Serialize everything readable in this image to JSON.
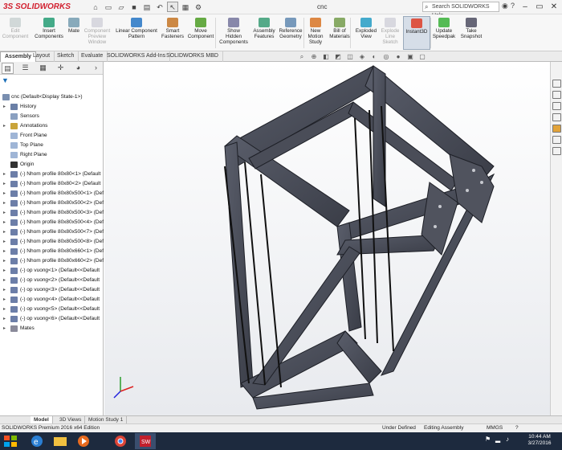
{
  "app": {
    "logo": "3S SOLIDWORKS",
    "window_title": "cnc",
    "search_placeholder": "Search SOLIDWORKS Help",
    "accent": "#d2202f"
  },
  "ribbon": {
    "buttons": [
      {
        "label1": "Edit",
        "label2": "Component",
        "enabled": false,
        "icon": "edit-component-icon"
      },
      {
        "label1": "Insert",
        "label2": "Components",
        "enabled": true,
        "icon": "insert-components-icon"
      },
      {
        "label1": "Mate",
        "label2": "",
        "enabled": true,
        "icon": "mate-icon"
      },
      {
        "label1": "Component",
        "label2": "Preview",
        "label3": "Window",
        "enabled": false,
        "icon": "preview-window-icon"
      },
      {
        "label1": "Linear Component",
        "label2": "Pattern",
        "enabled": true,
        "icon": "linear-pattern-icon"
      },
      {
        "label1": "Smart",
        "label2": "Fasteners",
        "enabled": true,
        "icon": "smart-fasteners-icon"
      },
      {
        "label1": "Move",
        "label2": "Component",
        "enabled": true,
        "icon": "move-component-icon"
      },
      {
        "label1": "Show",
        "label2": "Hidden",
        "label3": "Components",
        "enabled": true,
        "icon": "show-hidden-icon"
      },
      {
        "label1": "Assembly",
        "label2": "Features",
        "enabled": true,
        "icon": "assembly-features-icon"
      },
      {
        "label1": "Reference",
        "label2": "Geometry",
        "enabled": true,
        "icon": "reference-geometry-icon"
      },
      {
        "label1": "New",
        "label2": "Motion",
        "label3": "Study",
        "enabled": true,
        "icon": "motion-study-icon"
      },
      {
        "label1": "Bill of",
        "label2": "Materials",
        "enabled": true,
        "icon": "bom-icon"
      },
      {
        "label1": "Exploded",
        "label2": "View",
        "enabled": true,
        "icon": "exploded-view-icon"
      },
      {
        "label1": "Explode",
        "label2": "Line",
        "label3": "Sketch",
        "enabled": false,
        "icon": "explode-line-icon"
      },
      {
        "label1": "Instant3D",
        "label2": "",
        "enabled": true,
        "active": true,
        "icon": "instant3d-icon"
      },
      {
        "label1": "Update",
        "label2": "Speedpak",
        "enabled": true,
        "icon": "speedpak-icon"
      },
      {
        "label1": "Take",
        "label2": "Snapshot",
        "enabled": true,
        "icon": "snapshot-icon"
      }
    ]
  },
  "tabs": [
    "Assembly",
    "Layout",
    "Sketch",
    "Evaluate",
    "SOLIDWORKS Add-Ins",
    "SOLIDWORKS MBD"
  ],
  "tree": {
    "root": "cnc  (Default<Display State-1>)",
    "items": [
      {
        "label": "History",
        "kind": "history"
      },
      {
        "label": "Sensors",
        "kind": "sensors"
      },
      {
        "label": "Annotations",
        "kind": "annotations"
      },
      {
        "label": "Front Plane",
        "kind": "plane"
      },
      {
        "label": "Top Plane",
        "kind": "plane"
      },
      {
        "label": "Right Plane",
        "kind": "plane"
      },
      {
        "label": "Origin",
        "kind": "origin"
      },
      {
        "label": "(-) Nhom profile 80x80<1> (Default",
        "kind": "part"
      },
      {
        "label": "(-) Nhom profile 80x80<2> (Default",
        "kind": "part"
      },
      {
        "label": "(-) Nhom profile 80x80x500<1> (Def",
        "kind": "part"
      },
      {
        "label": "(-) Nhom profile 80x80x500<2> (Def",
        "kind": "part"
      },
      {
        "label": "(-) Nhom profile 80x80x500<3> (Def",
        "kind": "part"
      },
      {
        "label": "(-) Nhom profile 80x80x500<4> (Def",
        "kind": "part"
      },
      {
        "label": "(-) Nhom profile 80x80x500<7> (Def",
        "kind": "part"
      },
      {
        "label": "(-) Nhom profile 80x80x500<8> (Def",
        "kind": "part"
      },
      {
        "label": "(-) Nhom profile 80x80x660<1> (Def",
        "kind": "part"
      },
      {
        "label": "(-) Nhom profile 80x80x660<2> (Def",
        "kind": "part"
      },
      {
        "label": "(-) op vuong<1> (Default<<Default",
        "kind": "part"
      },
      {
        "label": "(-) op vuong<2> (Default<<Default",
        "kind": "part"
      },
      {
        "label": "(-) op vuong<3> (Default<<Default",
        "kind": "part"
      },
      {
        "label": "(-) op vuong<4> (Default<<Default",
        "kind": "part"
      },
      {
        "label": "(-) op vuong<5> (Default<<Default",
        "kind": "part"
      },
      {
        "label": "(-) op vuong<6> (Default<<Default",
        "kind": "part"
      },
      {
        "label": "Mates",
        "kind": "mates"
      }
    ]
  },
  "bottom_tabs": [
    "Model",
    "3D Views",
    "Motion Study 1"
  ],
  "status": {
    "left": "SOLIDWORKS Premium 2016 x64 Edition",
    "define": "Under Defined",
    "mode": "Editing Assembly",
    "units": "MMGS"
  },
  "taskbar": {
    "time": "10:44 AM",
    "date": "3/27/2016"
  }
}
